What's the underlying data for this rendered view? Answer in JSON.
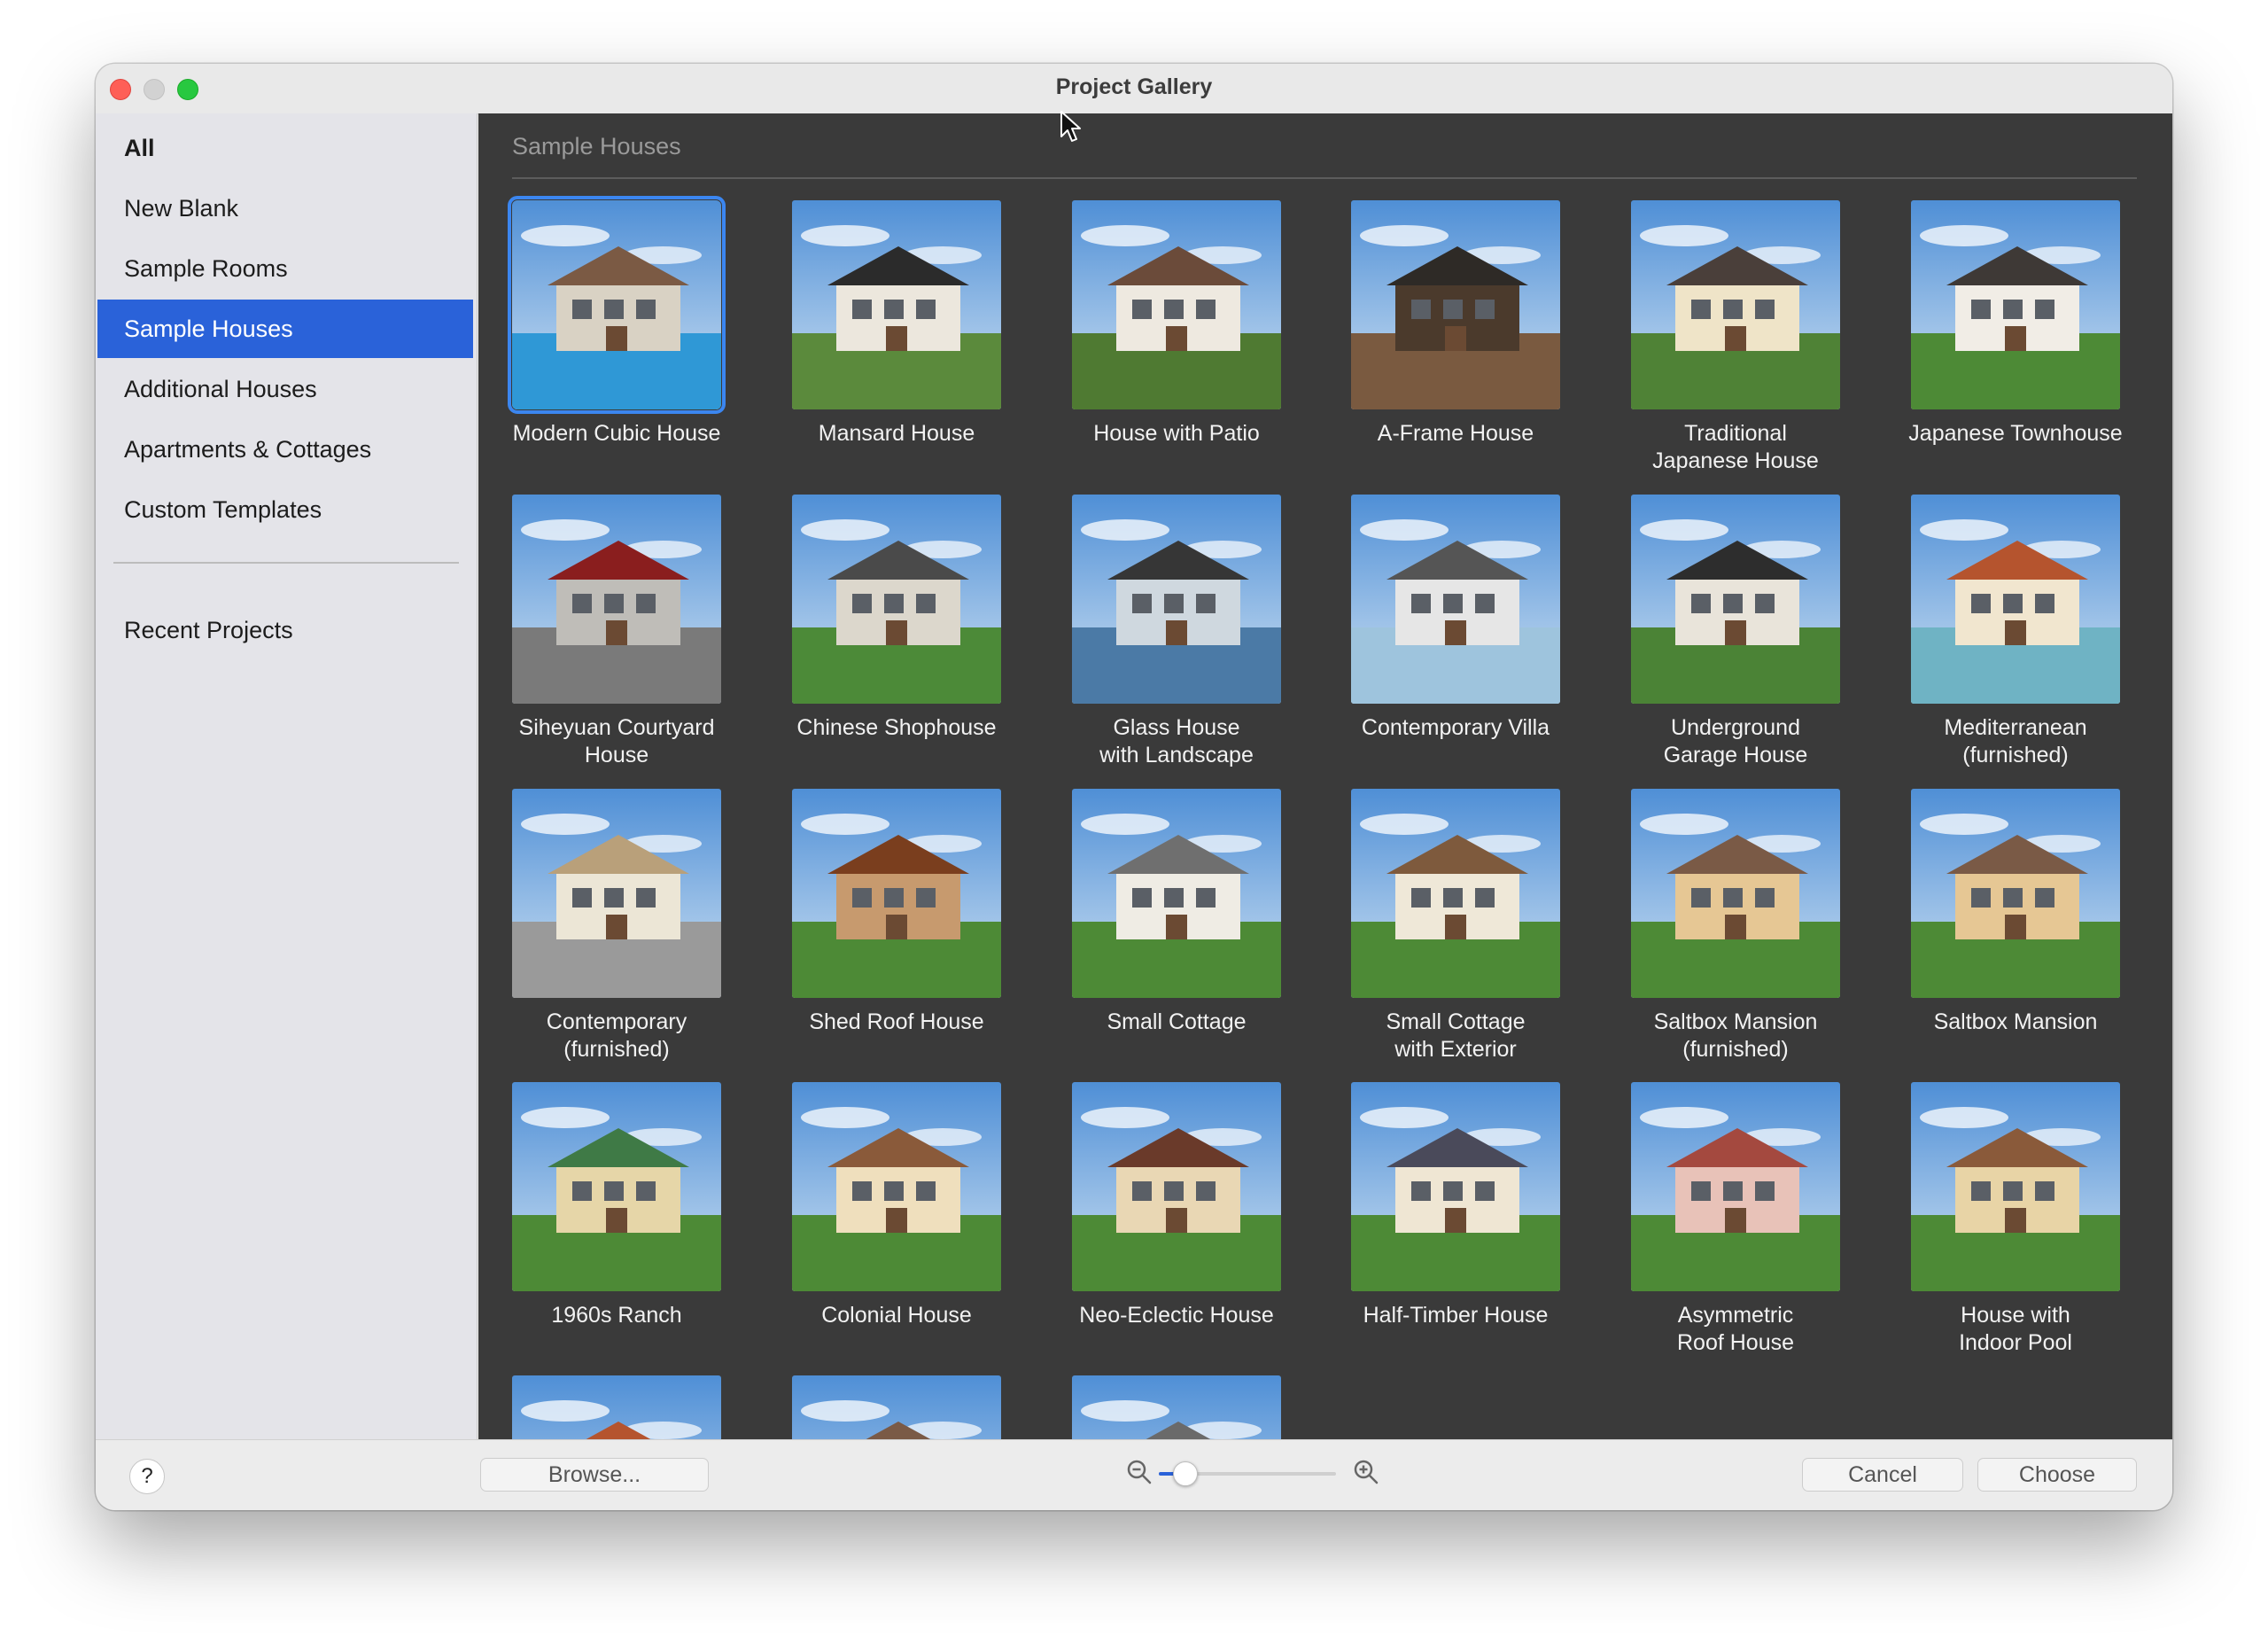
{
  "window": {
    "title": "Project Gallery"
  },
  "sidebar": {
    "items": [
      {
        "label": "All"
      },
      {
        "label": "New Blank"
      },
      {
        "label": "Sample Rooms"
      },
      {
        "label": "Sample Houses"
      },
      {
        "label": "Additional Houses"
      },
      {
        "label": "Apartments & Cottages"
      },
      {
        "label": "Custom Templates"
      }
    ],
    "selected": "Sample Houses",
    "recent": {
      "label": "Recent Projects"
    }
  },
  "main": {
    "section_title": "Sample Houses",
    "selected_project": "Modern Cubic House",
    "projects": [
      {
        "label": "Modern Cubic House"
      },
      {
        "label": "Mansard House"
      },
      {
        "label": "House with Patio"
      },
      {
        "label": "A-Frame House"
      },
      {
        "label": "Traditional\nJapanese House"
      },
      {
        "label": "Japanese Townhouse"
      },
      {
        "label": "Siheyuan Courtyard\nHouse"
      },
      {
        "label": "Chinese Shophouse"
      },
      {
        "label": "Glass House\nwith Landscape"
      },
      {
        "label": "Contemporary Villa"
      },
      {
        "label": "Underground\nGarage House"
      },
      {
        "label": "Mediterranean\n(furnished)"
      },
      {
        "label": "Contemporary\n(furnished)"
      },
      {
        "label": "Shed Roof House"
      },
      {
        "label": "Small Cottage"
      },
      {
        "label": "Small Cottage\nwith Exterior"
      },
      {
        "label": "Saltbox Mansion\n(furnished)"
      },
      {
        "label": "Saltbox Mansion"
      },
      {
        "label": "1960s Ranch"
      },
      {
        "label": "Colonial House"
      },
      {
        "label": "Neo-Eclectic House"
      },
      {
        "label": "Half-Timber House"
      },
      {
        "label": "Asymmetric\nRoof House"
      },
      {
        "label": "House with\nIndoor Pool"
      },
      {
        "label": ""
      },
      {
        "label": ""
      },
      {
        "label": ""
      }
    ]
  },
  "footer": {
    "help_label": "?",
    "browse_label": "Browse...",
    "cancel_label": "Cancel",
    "choose_label": "Choose",
    "zoom_level": 0.1
  },
  "colors": {
    "accent": "#2a62d9",
    "content_bg": "#3a3a3a",
    "sidebar_bg": "#e4e4e9"
  },
  "icons": {
    "zoom_out": "zoom-out-icon",
    "zoom_in": "zoom-in-icon",
    "cursor": "mouse-pointer-icon"
  }
}
